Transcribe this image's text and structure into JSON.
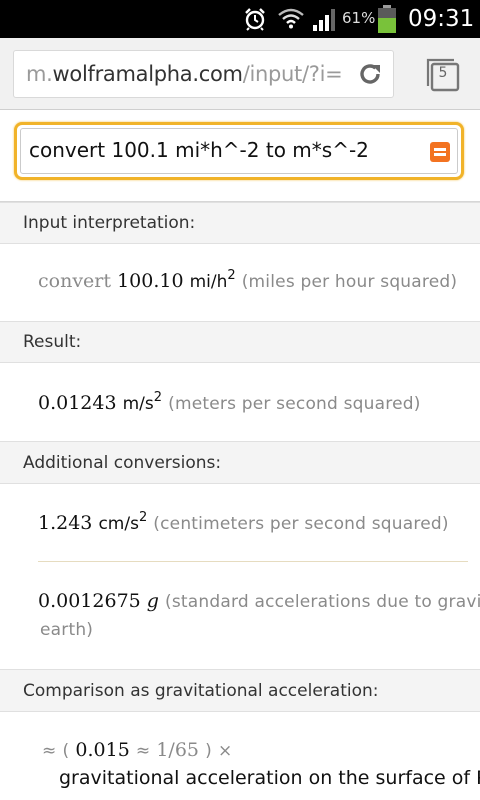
{
  "status_bar": {
    "battery_percent": "61%",
    "time": "09:31",
    "icons": [
      "alarm-icon",
      "wifi-icon",
      "signal-icon",
      "battery-icon"
    ]
  },
  "browser": {
    "url_prefix": "m.",
    "url_host": "wolframalpha.com",
    "url_path": "/input/?i=",
    "tabs_count": "5"
  },
  "query": {
    "text": "convert 100.1 mi*h^-2 to m*s^-2",
    "accent_color": "#f1b329",
    "button_color": "#f37321"
  },
  "pods": {
    "input_interpretation": {
      "title": "Input interpretation:",
      "prefix": "convert",
      "value": "100.10",
      "unit": "mi/h",
      "exponent": "2",
      "description": "(miles per hour squared)"
    },
    "result": {
      "title": "Result:",
      "value": "0.01243",
      "unit": "m/s",
      "exponent": "2",
      "description": "(meters per second squared)"
    },
    "additional_conversions": {
      "title": "Additional conversions:",
      "items": [
        {
          "value": "1.243",
          "unit": "cm/s",
          "exponent": "2",
          "description": "(centimeters per second squared)"
        },
        {
          "value": "0.0012675",
          "unit": "g",
          "description": "(standard accelerations due to gravity on the surface of the",
          "description_line2": "earth)"
        }
      ]
    },
    "comparison": {
      "title": "Comparison as gravitational acceleration:",
      "approx": "≈",
      "open": "(",
      "value": "0.015",
      "approx2": "≈",
      "fraction": "1/65",
      "close": ")",
      "times": "×",
      "description": "gravitational acceleration on the surface of Pluto"
    }
  }
}
